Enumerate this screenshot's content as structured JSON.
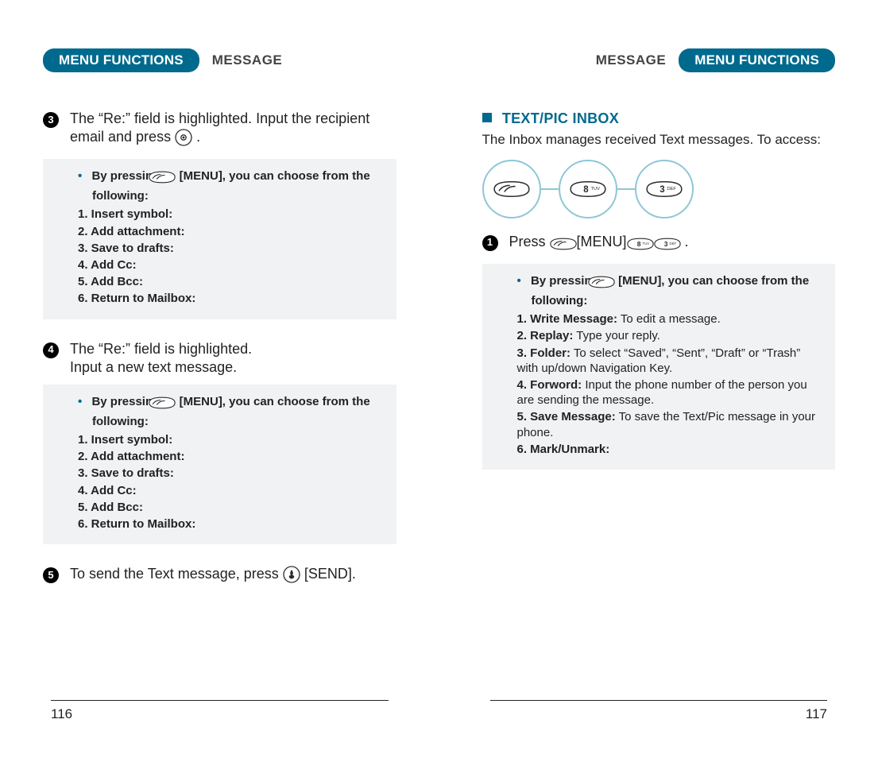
{
  "left": {
    "header_tab": "MENU FUNCTIONS",
    "header_section": "MESSAGE",
    "step3": {
      "num": "3",
      "text_a": "The “Re:” field is highlighted. Input the recipient",
      "text_b": "email and press",
      "period": "."
    },
    "box_a": {
      "lead_a": "By pressing",
      "lead_b": "[MENU], you can choose from the",
      "lead_c": "following:",
      "items": [
        "1. Insert symbol:",
        "2. Add attachment:",
        "3. Save to drafts:",
        "4. Add Cc:",
        "5. Add Bcc:",
        "6. Return to Mailbox:"
      ]
    },
    "step4": {
      "num": "4",
      "text_a": "The “Re:” field is highlighted.",
      "text_b": "Input a new text message."
    },
    "box_b": {
      "lead_a": "By pressing",
      "lead_b": "[MENU], you can choose from the",
      "lead_c": "following:",
      "items": [
        "1. Insert symbol:",
        "2. Add attachment:",
        "3. Save to drafts:",
        "4. Add Cc:",
        "5. Add Bcc:",
        "6. Return to Mailbox:"
      ]
    },
    "step5": {
      "num": "5",
      "text_a": "To send the Text message, press",
      "text_b": "[SEND]."
    },
    "page": "116"
  },
  "right": {
    "header_section": "MESSAGE",
    "header_tab": "MENU FUNCTIONS",
    "section_title": "TEXT/PIC INBOX",
    "intro": "The Inbox manages received Text messages. To access:",
    "step1": {
      "num": "1",
      "text_a": "Press",
      "text_b": "[MENU]",
      "period": "."
    },
    "box": {
      "lead_a": "By pressing",
      "lead_b": "[MENU], you can choose from the",
      "lead_c": "following:",
      "items": [
        {
          "b": "1. Write Message:",
          "d": " To edit a message."
        },
        {
          "b": "2. Replay:",
          "d": " Type your reply."
        },
        {
          "b": "3. Folder:",
          "d": " To select “Saved”, “Sent”, “Draft” or “Trash” with up/down Navigation Key."
        },
        {
          "b": "4. Forword:",
          "d": " Input the phone number of the person you are sending the message."
        },
        {
          "b": "5. Save Message:",
          "d": " To save the Text/Pic message in your phone."
        },
        {
          "b": "6. Mark/Unmark:",
          "d": ""
        }
      ]
    },
    "page": "117"
  }
}
